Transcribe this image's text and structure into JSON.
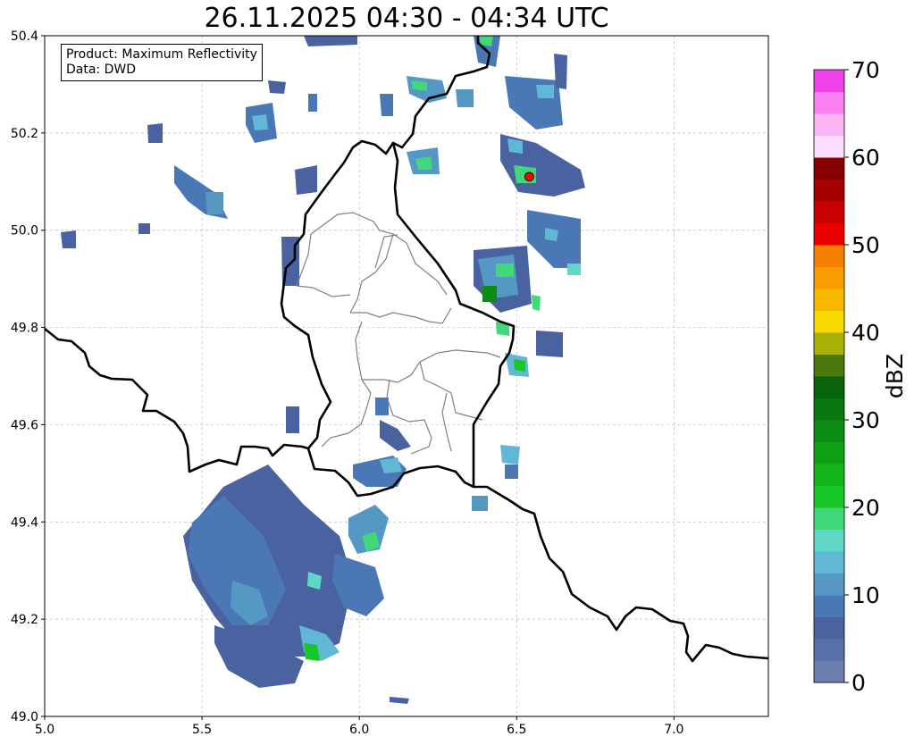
{
  "title": "26.11.2025 04:30 - 04:34 UTC",
  "info": {
    "product_line": "Product: Maximum Reflectivity",
    "data_line": "Data: DWD"
  },
  "axes": {
    "x_ticks": [
      "5.0",
      "5.5",
      "6.0",
      "6.5",
      "7.0"
    ],
    "y_ticks": [
      "49.0",
      "49.2",
      "49.4",
      "49.6",
      "49.8",
      "50.0",
      "50.2",
      "50.4"
    ],
    "xlim": [
      5.0,
      7.3
    ],
    "ylim": [
      49.0,
      50.4
    ],
    "grid": true
  },
  "colorbar": {
    "label": "dBZ",
    "ticks": [
      "0",
      "10",
      "20",
      "30",
      "40",
      "50",
      "60",
      "70"
    ],
    "range": [
      0,
      70
    ],
    "colors": [
      "#6a7fb0",
      "#5a70a8",
      "#4a62a0",
      "#4a78b4",
      "#5698c4",
      "#60b8d4",
      "#60d8c8",
      "#40d878",
      "#18c828",
      "#14b41c",
      "#10a018",
      "#0c8c14",
      "#0a7810",
      "#0a640c",
      "#4c7810",
      "#a8b008",
      "#f8d800",
      "#f8b800",
      "#f89c00",
      "#f88000",
      "#e80000",
      "#c80000",
      "#a80000",
      "#880000",
      "#fcdcfc",
      "#fcb4f4",
      "#f880f0",
      "#f040e8"
    ]
  },
  "marker": {
    "color": "#ff0000",
    "lon": 6.54,
    "lat": 50.11
  }
}
